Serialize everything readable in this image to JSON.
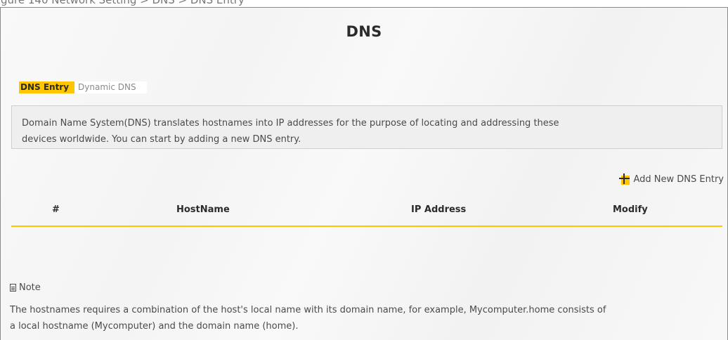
{
  "caption": "gure 140 Network Setting > DNS > DNS Entry",
  "page": {
    "title": "DNS"
  },
  "tabs": [
    {
      "label": "DNS Entry",
      "active": true
    },
    {
      "label": "Dynamic DNS",
      "active": false
    }
  ],
  "info": {
    "line1": "Domain Name System(DNS) translates hostnames into IP addresses for the purpose of locating and addressing these",
    "line2": "devices worldwide. You can start by adding a new DNS entry."
  },
  "actions": {
    "add_label": "Add New DNS Entry",
    "add_icon": "plus-icon"
  },
  "table": {
    "columns": [
      "#",
      "HostName",
      "IP Address",
      "Modify"
    ],
    "rows": []
  },
  "note": {
    "heading": "Note",
    "line1": "The hostnames requires a combination of the host's local name with its domain name, for example, Mycomputer.home consists of",
    "line2": "a local hostname (Mycomputer) and the domain name (home)."
  },
  "colors": {
    "accent": "#ffc600",
    "panel_bg": "#efefef",
    "text": "#4a4a4a"
  }
}
